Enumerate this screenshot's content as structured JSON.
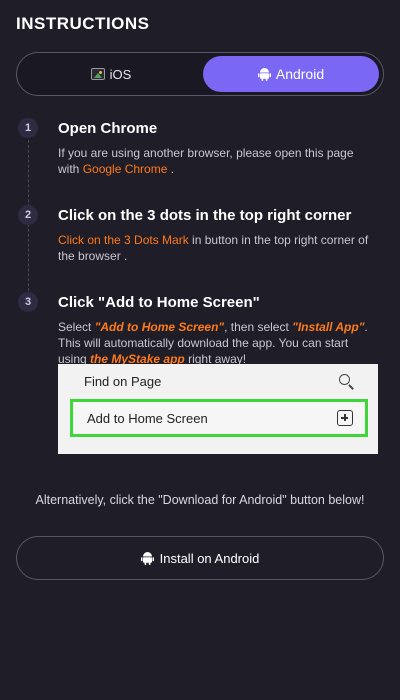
{
  "header": {
    "title": "INSTRUCTIONS"
  },
  "platform_toggle": {
    "ios_label": "iOS",
    "android_label": "Android",
    "selected": "Android",
    "accent_color": "#7a68f5"
  },
  "steps": [
    {
      "number": "1",
      "title": "Open Chrome",
      "desc_prefix": "If you are using another browser, please open this page with ",
      "desc_highlight": "Google Chrome",
      "desc_suffix": " ."
    },
    {
      "number": "2",
      "title": "Click on the 3 dots in the top right corner",
      "desc_highlight": "Click on the 3 Dots Mark",
      "desc_suffix": " in button in the top right corner of the browser ."
    },
    {
      "number": "3",
      "title": "Click \"Add to Home Screen\"",
      "desc_part1": "Select ",
      "desc_hl1": "\"Add to Home Screen\"",
      "desc_part2": ", then select ",
      "desc_hl2": "\"Install App\"",
      "desc_part3": ". This will automatically download the app. You can start using ",
      "desc_hl3": "the MyStake app",
      "desc_part4": " right away!"
    }
  ],
  "menu_screenshot": {
    "find_label": "Find on Page",
    "add_label": "Add to Home Screen",
    "find_icon": "search-icon",
    "add_icon": "add-box-icon",
    "highlight_color": "#3fd63a"
  },
  "footer": {
    "alt_text": "Alternatively, click the \"Download for Android\" button below!",
    "install_label": "Install on Android"
  },
  "colors": {
    "background": "#1f1d27",
    "highlight": "#ff7a1a"
  }
}
